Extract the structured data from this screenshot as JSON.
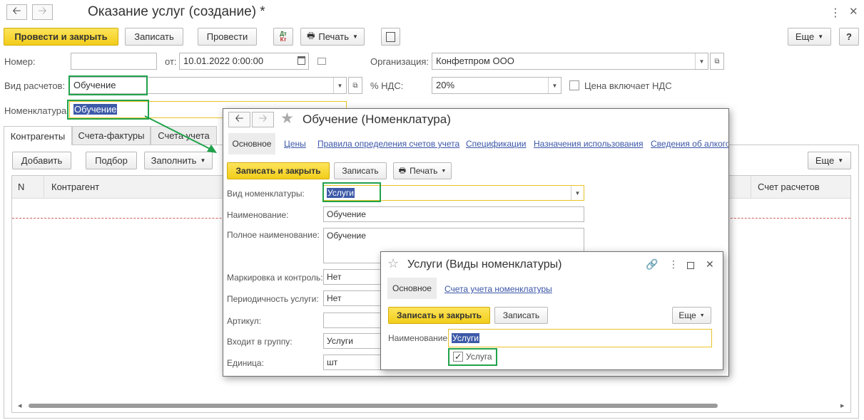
{
  "main": {
    "title": "Оказание услуг (создание) *",
    "toolbar": {
      "post_close": "Провести и закрыть",
      "save": "Записать",
      "post": "Провести",
      "dtkt_top": "Дт",
      "dtkt_bottom": "Кт",
      "print": "Печать",
      "more": "Еще",
      "help": "?"
    },
    "form": {
      "number_label": "Номер:",
      "number_value": "",
      "date_label": "от:",
      "date_value": "10.01.2022  0:00:00",
      "org_label": "Организация:",
      "org_value": "Конфетпром ООО",
      "settlement_label": "Вид расчетов:",
      "settlement_value": "Обучение",
      "vat_label": "% НДС:",
      "vat_value": "20%",
      "price_incl_vat_label": "Цена включает НДС",
      "nomenclature_label": "Номенклатура:",
      "nomenclature_value": "Обучение"
    },
    "tabs": [
      "Контрагенты",
      "Счета-фактуры",
      "Счета учета"
    ],
    "table_toolbar": {
      "add": "Добавить",
      "pick": "Подбор",
      "fill": "Заполнить",
      "more": "Еще"
    },
    "table_headers": {
      "n": "N",
      "counterparty": "Контрагент",
      "account": "Счет расчетов"
    }
  },
  "nomenclature_window": {
    "title": "Обучение (Номенклатура)",
    "tabs": {
      "main": "Основное",
      "prices": "Цены",
      "account_rules": "Правила определения счетов учета",
      "specs": "Спецификации",
      "usage": "Назначения использования",
      "alcohol": "Сведения об алкого"
    },
    "toolbar": {
      "save_close": "Записать и закрыть",
      "save": "Записать",
      "print": "Печать"
    },
    "fields": {
      "kind_label": "Вид номенклатуры:",
      "kind_value": "Услуги",
      "name_label": "Наименование:",
      "name_value": "Обучение",
      "full_name_label": "Полное наименование:",
      "full_name_value": "Обучение",
      "marking_label": "Маркировка и контроль:",
      "marking_value": "Нет",
      "periodicity_label": "Периодичность услуги:",
      "periodicity_value": "Нет",
      "article_label": "Артикул:",
      "article_value": "",
      "group_label": "Входит в группу:",
      "group_value": "Услуги",
      "unit_label": "Единица:",
      "unit_value": "шт"
    }
  },
  "kind_window": {
    "title": "Услуги (Виды номенклатуры)",
    "tabs": {
      "main": "Основное",
      "accounts": "Счета учета номенклатуры"
    },
    "toolbar": {
      "save_close": "Записать и закрыть",
      "save": "Записать",
      "more": "Еще"
    },
    "name_label": "Наименование:",
    "name_value": "Услуги",
    "service_checkbox_label": "Услуга",
    "service_checked": true
  },
  "colors": {
    "highlight_green": "#21a24c",
    "yellow_button": "#f2cd1a",
    "selection": "#3d5aa8",
    "link": "#3b56a8"
  }
}
